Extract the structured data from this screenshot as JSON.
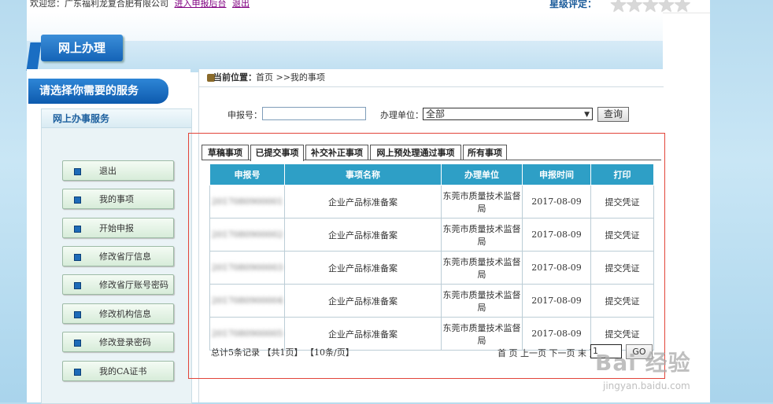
{
  "topbar": {
    "welcome_text": "欢迎您：广东福利龙复合肥有限公司",
    "link_backend": "进入申报后台",
    "link_logout": "退出",
    "rating_label": "星级评定：",
    "stars": "★★★★★"
  },
  "banner": {
    "title": "网上办理"
  },
  "sidebar": {
    "title": "请选择你需要的服务",
    "panel_title": "网上办事服务",
    "items": [
      {
        "label": "退出"
      },
      {
        "label": "我的事项"
      },
      {
        "label": "开始申报"
      },
      {
        "label": "修改省厅信息"
      },
      {
        "label": "修改省厅账号密码"
      },
      {
        "label": "修改机构信息"
      },
      {
        "label": "修改登录密码"
      },
      {
        "label": "我的CA证书"
      }
    ]
  },
  "breadcrumb": {
    "label": "当前位置：",
    "path": "首页 >>我的事项"
  },
  "filter": {
    "report_no_label": "申报号：",
    "report_no_value": "",
    "unit_label": "办理单位：",
    "unit_value": "全部",
    "query_button": "查询"
  },
  "tabs": [
    {
      "label": "草稿事项",
      "active": false
    },
    {
      "label": "已提交事项",
      "active": true
    },
    {
      "label": "补交补正事项",
      "active": false
    },
    {
      "label": "网上预处理通过事项",
      "active": false
    },
    {
      "label": "所有事项",
      "active": false
    }
  ],
  "table": {
    "headers": [
      "申报号",
      "事项名称",
      "办理单位",
      "申报时间",
      "打印"
    ],
    "rows": [
      {
        "no": "2017080900001",
        "name": "企业产品标准备案",
        "unit": "东莞市质量技术监督局",
        "date": "2017-08-09",
        "print": "提交凭证"
      },
      {
        "no": "2017080900002",
        "name": "企业产品标准备案",
        "unit": "东莞市质量技术监督局",
        "date": "2017-08-09",
        "print": "提交凭证"
      },
      {
        "no": "2017080900003",
        "name": "企业产品标准备案",
        "unit": "东莞市质量技术监督局",
        "date": "2017-08-09",
        "print": "提交凭证"
      },
      {
        "no": "2017080900004",
        "name": "企业产品标准备案",
        "unit": "东莞市质量技术监督局",
        "date": "2017-08-09",
        "print": "提交凭证"
      },
      {
        "no": "2017080900005",
        "name": "企业产品标准备案",
        "unit": "东莞市质量技术监督局",
        "date": "2017-08-09",
        "print": "提交凭证"
      }
    ]
  },
  "footer": {
    "summary": "总计5条记录 【共1页】 【10条/页】",
    "pager": "首 页 上一页 下一页 末 页",
    "page_value": "1",
    "go_button": "GO"
  },
  "watermark": {
    "text": "Bai 经验",
    "sub": "jingyan.baidu.com"
  },
  "colors": {
    "accent": "#2e9fc6",
    "highlight": "#e2453a",
    "brand": "#1463b7"
  }
}
